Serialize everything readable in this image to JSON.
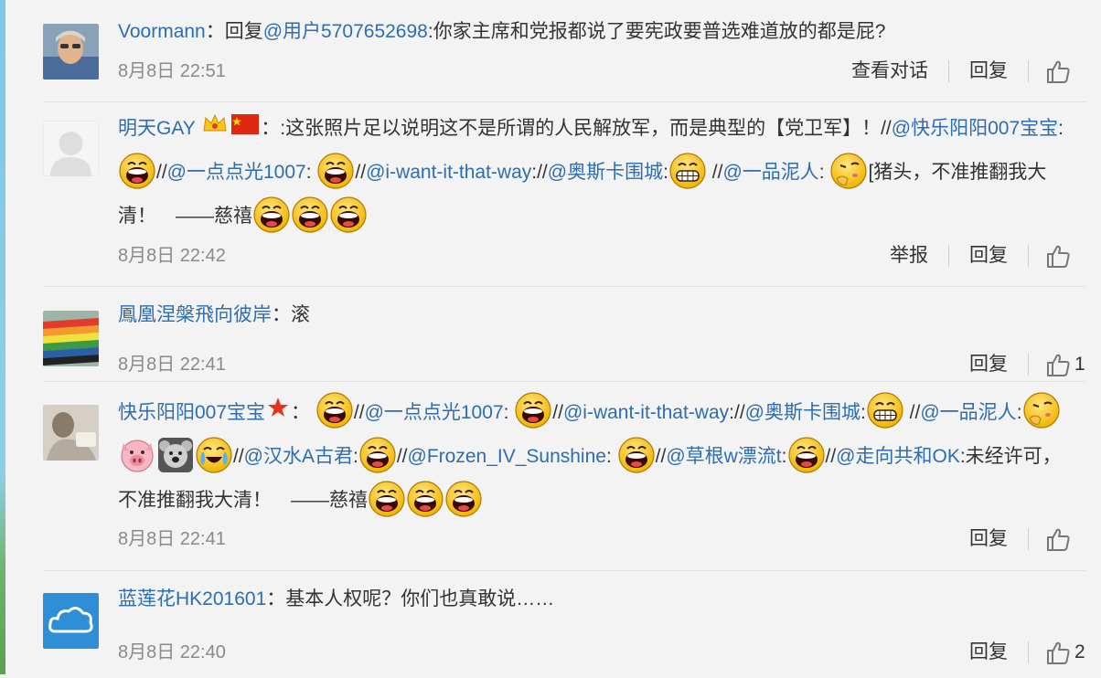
{
  "comments": [
    {
      "user": "Voormann",
      "sep": "：",
      "reply_prefix": "回复",
      "reply_to": "@用户5707652698",
      "text": ":你家主席和党报都说了要宪政要普选难道放的都是屁?",
      "time": "8月8日 22:51",
      "action1": "查看对话",
      "reply": "回复",
      "likes": ""
    },
    {
      "user": "明天GAY",
      "seg1": "：:这张照片足以说明这不是所谓的人民解放军，而是典型的【党卫军】！//",
      "at1": "@快乐阳阳007宝宝",
      "seg2": ":",
      "seg3": "//",
      "at2": "@一点点光1007",
      "seg4": ":",
      "seg5": "//",
      "at3": "@i-want-it-that-way",
      "seg6": "://",
      "at4": "@奥斯卡围城",
      "seg7": ":",
      "seg8": " //",
      "at5": "@一品泥人",
      "seg9": ":",
      "seg10": "[猪头，不准推翻我大清！　——慈禧",
      "time": "8月8日 22:42",
      "action1": "举报",
      "reply": "回复",
      "likes": ""
    },
    {
      "user": "鳳凰涅槃飛向彼岸",
      "text": "：滚",
      "time": "8月8日 22:41",
      "reply": "回复",
      "likes": "1"
    },
    {
      "user": "快乐阳阳007宝宝",
      "seg1": "：",
      "seg2": "//",
      "at1": "@一点点光1007",
      "seg3": ":",
      "seg4": "//",
      "at2": "@i-want-it-that-way",
      "seg5": "://",
      "at3": "@奥斯卡围城",
      "seg6": ":",
      "seg7": " //",
      "at4": "@一品泥人",
      "seg8": ":",
      "seg9": "//",
      "at5": "@汉水A古君",
      "seg10": ":",
      "seg11": "//",
      "at6": "@Frozen_IV_Sunshine",
      "seg12": ":",
      "seg13": "//",
      "at7": "@草根w漂流t",
      "seg14": ":",
      "seg15": "//",
      "at8": "@走向共和OK",
      "seg16": ":未经许可，不准推翻我大清！　——慈禧",
      "time": "8月8日 22:41",
      "reply": "回复",
      "likes": ""
    },
    {
      "user": "蓝莲花HK201601",
      "text": "：基本人权呢？你们也真敢说……",
      "time": "8月8日 22:40",
      "reply": "回复",
      "likes": "2"
    }
  ],
  "colors": {
    "link": "#2d6db0",
    "text": "#333333",
    "time": "#8a8a8a",
    "background": "#f3f3f3"
  },
  "icons": [
    "thumbs-up-icon",
    "laugh-emoji-icon",
    "grin-emoji-icon",
    "pig-face-icon",
    "koala-face-icon",
    "crying-laugh-icon",
    "crown-icon",
    "china-flag-icon",
    "red-star-icon"
  ]
}
